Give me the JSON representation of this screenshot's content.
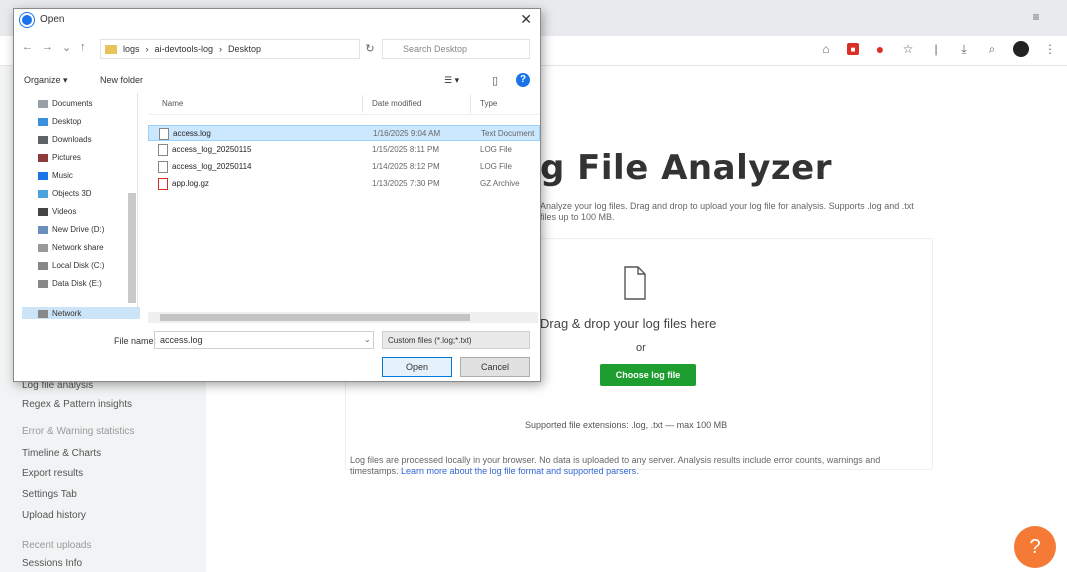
{
  "browser": {
    "toolbar_icons": [
      "extension-icon",
      "pdf-icon",
      "record-icon",
      "star-icon",
      "profile-icon",
      "menu-icon"
    ]
  },
  "page": {
    "title": "g File Analyzer",
    "intro": "Analyze your log files. Drag and drop to upload your log file for analysis. Supports .log and .txt files up to 100 MB.",
    "drop_text": "Drag & drop your log files here",
    "or_text": "or",
    "choose_button": "Choose log file",
    "note": "Supported file extensions: .log, .txt — max 100 MB",
    "paragraph": "Log files are processed locally in your browser. No data is uploaded to any server. Analysis results include error counts, warnings and timestamps.",
    "paragraph_link": "Learn more about the log file format and supported parsers.",
    "help_button": "?"
  },
  "sidebar": {
    "items": [
      {
        "label": "Log file analysis"
      },
      {
        "label": "Regex & Pattern insights"
      },
      {
        "label": "Error & Warning statistics"
      },
      {
        "label": "Timeline & Charts"
      },
      {
        "label": "Export results"
      },
      {
        "label": "Settings Tab"
      },
      {
        "label": "Upload history"
      },
      {
        "label": "Recent uploads"
      },
      {
        "label": "Sessions Info"
      }
    ]
  },
  "dialog": {
    "title": "Open",
    "close": "✕",
    "address": [
      "logs",
      "ai-devtools-log",
      "Desktop"
    ],
    "search_placeholder": "Search Desktop",
    "organize": "Organize ▾",
    "new_folder": "New folder",
    "view_label": "☰ ▾",
    "nav_items": [
      {
        "label": "Documents"
      },
      {
        "label": "Desktop"
      },
      {
        "label": "Downloads"
      },
      {
        "label": "Pictures"
      },
      {
        "label": "Music"
      },
      {
        "label": "Objects 3D"
      },
      {
        "label": "Videos"
      },
      {
        "label": "New Drive (D:)"
      },
      {
        "label": "Network share"
      },
      {
        "label": "Local Disk (C:)"
      },
      {
        "label": "Data Disk (E:)"
      },
      {
        "label": "Network"
      }
    ],
    "columns": {
      "name": "Name",
      "date": "Date modified",
      "type": "Type"
    },
    "files": [
      {
        "name": "access.log",
        "date": "1/16/2025 9:04 AM",
        "type": "Text Document"
      },
      {
        "name": "access_log_20250115",
        "date": "1/15/2025 8:11 PM",
        "type": "LOG File"
      },
      {
        "name": "access_log_20250114",
        "date": "1/14/2025 8:12 PM",
        "type": "LOG File"
      },
      {
        "name": "app.log.gz",
        "date": "1/13/2025 7:30 PM",
        "type": "GZ Archive"
      }
    ],
    "filename_label": "File name:",
    "filename_value": "access.log",
    "type_value": "Custom files (*.log;*.txt)",
    "open_button": "Open",
    "cancel_button": "Cancel"
  }
}
